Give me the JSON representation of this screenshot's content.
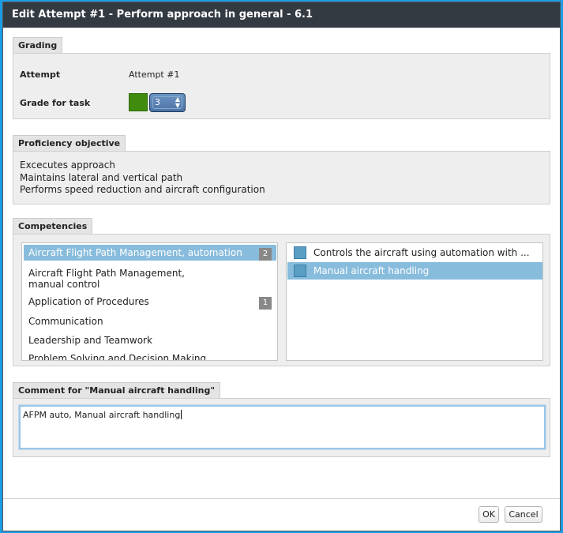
{
  "dialog": {
    "title": "Edit Attempt #1 - Perform approach in general - 6.1"
  },
  "grading": {
    "tab": "Grading",
    "attempt_label": "Attempt",
    "attempt_value": "Attempt #1",
    "grade_label": "Grade for task",
    "grade_value": "3",
    "grade_color": "#418c0e"
  },
  "proficiency": {
    "tab": "Proficiency objective",
    "lines": [
      "Excecutes approach",
      "Maintains lateral and vertical path",
      "Performs speed reduction and aircraft configuration"
    ]
  },
  "competencies": {
    "tab": "Competencies",
    "items": [
      {
        "label": "Aircraft Flight Path Management, automation",
        "badge": "2"
      },
      {
        "label": "Aircraft Flight Path Management, manual control",
        "badge": ""
      },
      {
        "label": "Application of Procedures",
        "badge": "1"
      },
      {
        "label": "Communication",
        "badge": ""
      },
      {
        "label": "Leadership and Teamwork",
        "badge": ""
      },
      {
        "label": "Problem Solving and Decision Making",
        "badge": ""
      }
    ],
    "behaviours": [
      {
        "label": "Controls the aircraft using automation with ..."
      },
      {
        "label": "Manual aircraft handling"
      }
    ]
  },
  "comment": {
    "tab": "Comment for \"Manual aircraft handling\"",
    "text": "AFPM auto, Manual aircraft handling"
  },
  "footer": {
    "ok_label": "OK",
    "cancel_label": "Cancel"
  },
  "colors": {
    "selection": "#88bcdc",
    "titlebar": "#343a42",
    "accent_border": "#1b9de6"
  }
}
